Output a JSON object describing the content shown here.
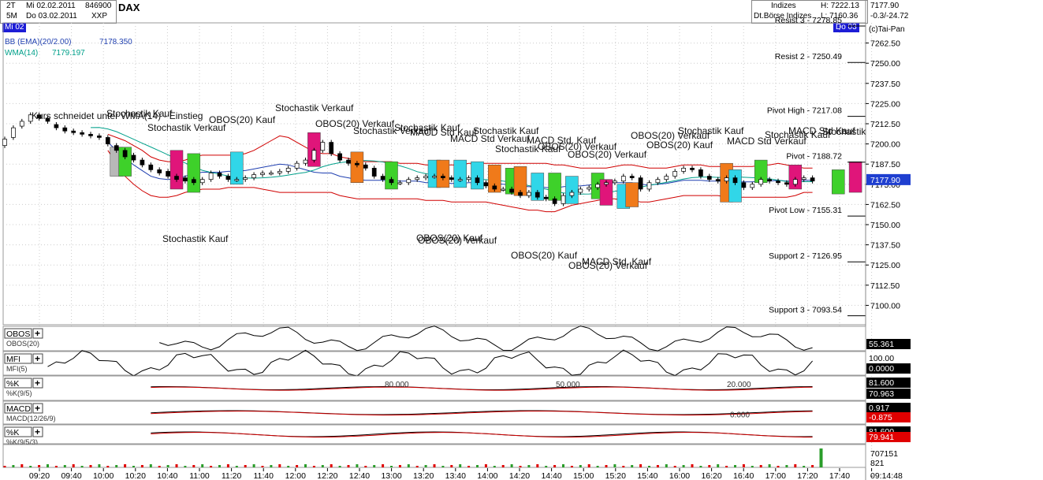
{
  "header": {
    "period1": "2T",
    "date1": "Mi 02.02.2011",
    "code": "846900",
    "title": "DAX",
    "period2": "5M",
    "date2": "Do 03.02.2011",
    "exchange_code": "XXP",
    "market": "Indizes",
    "exchange": "Dt.Börse Indizes",
    "high": "H: 7222.13",
    "low": "L: 7160.36",
    "last": "7177.90",
    "change": "-0.3/-24.72",
    "copyright": "(c)Tai-Pan",
    "day_start": "Mi 02",
    "day_end": "Do 03"
  },
  "legend": {
    "bb_label": "BB (EMA)(20/2.00)",
    "bb_value": "7178.350",
    "wma_label": "WMA(14)",
    "wma_value": "7179.197"
  },
  "colors": {
    "bb": "#d00000",
    "wma": "#1f3fb0",
    "ema": "#00a08a",
    "price_box": "#1f3fd0",
    "neg_box": "#e00000",
    "obos_box": "#f07a1a",
    "stoch_buy": "#3ed12a",
    "stoch_sell": "#e0157a",
    "macd_box": "#31d6e8",
    "gray_box": "#b8b8b8"
  },
  "chart_data": {
    "type": "candlestick",
    "title": "DAX",
    "y_range": [
      7088,
      7275
    ],
    "y_ticks": [
      "7262.50",
      "7250.00",
      "7237.50",
      "7225.00",
      "7212.50",
      "7200.00",
      "7187.50",
      "7175.00",
      "7162.50",
      "7150.00",
      "7137.50",
      "7125.00",
      "7112.50",
      "7100.00"
    ],
    "x_ticks": [
      "09:20",
      "09:40",
      "10:00",
      "10:20",
      "10:40",
      "11:00",
      "11:20",
      "11:40",
      "12:00",
      "12:20",
      "12:40",
      "13:00",
      "13:20",
      "13:40",
      "14:00",
      "14:20",
      "14:40",
      "15:00",
      "15:20",
      "15:40",
      "16:00",
      "16:20",
      "16:40",
      "17:00",
      "17:20",
      "17:40",
      "-"
    ],
    "current_price": "7177.90",
    "time_label": "09:14:48",
    "close": [
      7203,
      7210,
      7214,
      7218,
      7216,
      7214,
      7210,
      7208,
      7207,
      7206,
      7205,
      7204,
      7200,
      7196,
      7192,
      7190,
      7187,
      7184,
      7182,
      7180,
      7178,
      7177,
      7176,
      7178,
      7182,
      7180,
      7178,
      7178,
      7179,
      7181,
      7182,
      7182,
      7183,
      7185,
      7188,
      7190,
      7196,
      7201,
      7194,
      7190,
      7188,
      7187,
      7185,
      7180,
      7178,
      7176,
      7176,
      7178,
      7179,
      7180,
      7180,
      7179,
      7178,
      7178,
      7179,
      7176,
      7174,
      7172,
      7172,
      7170,
      7168,
      7170,
      7167,
      7166,
      7163,
      7168,
      7170,
      7172,
      7173,
      7175,
      7176,
      7177,
      7180,
      7179,
      7172,
      7176,
      7178,
      7180,
      7183,
      7185,
      7184,
      7180,
      7178,
      7177,
      7179,
      7176,
      7173,
      7175,
      7178,
      7177,
      7176,
      7175,
      7178,
      7179,
      7177
    ],
    "open": [
      7199,
      7204,
      7211,
      7214,
      7218,
      7216,
      7212,
      7210,
      7208,
      7207,
      7206,
      7205,
      7204,
      7199,
      7196,
      7193,
      7190,
      7187,
      7184,
      7183,
      7180,
      7179,
      7178,
      7176,
      7178,
      7182,
      7180,
      7178,
      7178,
      7179,
      7181,
      7182,
      7182,
      7183,
      7185,
      7188,
      7190,
      7196,
      7201,
      7194,
      7190,
      7188,
      7187,
      7185,
      7180,
      7178,
      7176,
      7176,
      7178,
      7179,
      7180,
      7180,
      7179,
      7178,
      7178,
      7179,
      7176,
      7174,
      7172,
      7172,
      7170,
      7168,
      7170,
      7167,
      7166,
      7163,
      7168,
      7170,
      7172,
      7173,
      7175,
      7176,
      7177,
      7180,
      7179,
      7172,
      7176,
      7178,
      7180,
      7183,
      7185,
      7184,
      7180,
      7178,
      7177,
      7179,
      7176,
      7173,
      7175,
      7178,
      7177,
      7176,
      7175,
      7178,
      7179
    ],
    "bb_upper": [
      null,
      null,
      null,
      null,
      null,
      null,
      null,
      null,
      null,
      null,
      null,
      null,
      7206,
      7204,
      7202,
      7199,
      7196,
      7192,
      7190,
      7189,
      7189,
      7190,
      7192,
      7193,
      7193,
      7193,
      7193,
      7193,
      7194,
      7196,
      7199,
      7202,
      7205,
      7204,
      7201,
      7198,
      7195,
      7194,
      7194,
      7192,
      7191,
      7190,
      7189,
      7189,
      7189,
      7189,
      7188,
      7188,
      7188,
      7187,
      7187,
      7187,
      7187,
      7187,
      7188,
      7188,
      7188,
      7188,
      7188,
      7188,
      7188,
      7188,
      7188,
      7188,
      7187,
      7187,
      7186,
      7185,
      7185,
      7185,
      7185,
      7186,
      7187,
      7187,
      7186,
      7185,
      7185,
      7185,
      7186,
      7187,
      7187,
      7187,
      7186,
      7186,
      7186,
      7186,
      7186,
      7186,
      7187,
      7187,
      7188,
      7187,
      7186,
      7185,
      7185
    ],
    "bb_lower": [
      null,
      null,
      null,
      null,
      null,
      null,
      null,
      null,
      null,
      null,
      null,
      null,
      7196,
      7188,
      7180,
      7175,
      7171,
      7168,
      7167,
      7167,
      7168,
      7170,
      7171,
      7172,
      7172,
      7172,
      7173,
      7173,
      7173,
      7173,
      7172,
      7171,
      7170,
      7170,
      7170,
      7170,
      7170,
      7170,
      7170,
      7168,
      7167,
      7166,
      7166,
      7166,
      7166,
      7166,
      7166,
      7166,
      7166,
      7165,
      7165,
      7165,
      7164,
      7164,
      7164,
      7164,
      7164,
      7163,
      7162,
      7161,
      7160,
      7159,
      7159,
      7158,
      7158,
      7160,
      7162,
      7163,
      7164,
      7165,
      7166,
      7166,
      7165,
      7165,
      7164,
      7164,
      7165,
      7166,
      7167,
      7168,
      7168,
      7168,
      7168,
      7168,
      7167,
      7167,
      7167,
      7167,
      7167,
      7167,
      7167,
      7167,
      7168,
      7170,
      7170
    ],
    "pivot_levels": [
      {
        "label": "Resist 3 - 7278.85",
        "value": 7278.85
      },
      {
        "label": "Resist 2 - 7250.49",
        "value": 7250.49
      },
      {
        "label": "Pivot High - 7217.08",
        "value": 7217.08
      },
      {
        "label": "Pivot - 7188.72",
        "value": 7188.72
      },
      {
        "label": "Pivot Low - 7155.31",
        "value": 7155.31
      },
      {
        "label": "Support 2 - 7126.95",
        "value": 7126.95
      },
      {
        "label": "Support 3 - 7093.54",
        "value": 7093.54
      }
    ],
    "annotations": [
      {
        "text": "Kurs schneidet unter WMA(14) - Einstieg",
        "x": 40,
        "y": 151
      },
      {
        "text": "Stochastik Kauf",
        "x": 135,
        "y": 148
      },
      {
        "text": "Stochastik Verkauf",
        "x": 187,
        "y": 166
      },
      {
        "text": "OBOS(20) Kauf",
        "x": 265,
        "y": 156
      },
      {
        "text": "Stochastik Verkauf",
        "x": 349,
        "y": 141
      },
      {
        "text": "OBOS(20) Verkauf",
        "x": 400,
        "y": 161
      },
      {
        "text": "Stochastik Verkauf",
        "x": 448,
        "y": 170
      },
      {
        "text": "Stochastik Kauf",
        "x": 500,
        "y": 166
      },
      {
        "text": "MACD Std Kauf",
        "x": 520,
        "y": 172
      },
      {
        "text": "MACD Std Verkauf",
        "x": 571,
        "y": 180
      },
      {
        "text": "Stochastik Kauf",
        "x": 600,
        "y": 170
      },
      {
        "text": "MACD Std. Kauf",
        "x": 668,
        "y": 182
      },
      {
        "text": "Stochastik Kauf",
        "x": 628,
        "y": 193
      },
      {
        "text": "OBOS(20) Verkauf",
        "x": 682,
        "y": 190
      },
      {
        "text": "OBOS(20) Verkauf",
        "x": 720,
        "y": 200
      },
      {
        "text": "Stochastik Kauf",
        "x": 860,
        "y": 170
      },
      {
        "text": "OBOS(20) Verkauf",
        "x": 800,
        "y": 176
      },
      {
        "text": "OBOS(20) Kauf",
        "x": 820,
        "y": 188
      },
      {
        "text": "MACD Std Verkauf",
        "x": 922,
        "y": 183
      },
      {
        "text": "Stochastik Kauf",
        "x": 970,
        "y": 175
      },
      {
        "text": "MACD Std Kauf",
        "x": 1000,
        "y": 170
      },
      {
        "text": "Stochastik",
        "x": 1043,
        "y": 171
      },
      {
        "text": "Stochastik Kauf",
        "x": 206,
        "y": 307
      },
      {
        "text": "OBOS(20) Kauf",
        "x": 528,
        "y": 306
      },
      {
        "text": "OBOS(20) Verkauf",
        "x": 530,
        "y": 309
      },
      {
        "text": "OBOS(20) Kauf",
        "x": 648,
        "y": 328
      },
      {
        "text": "MACD Std. Kauf",
        "x": 738,
        "y": 336
      },
      {
        "text": "OBOS(20) Verkauf",
        "x": 721,
        "y": 341
      }
    ],
    "signal_boxes": [
      {
        "i": 13,
        "color": "gray_box",
        "lo": 7180,
        "hi": 7198
      },
      {
        "i": 14,
        "color": "stoch_buy",
        "lo": 7180,
        "hi": 7198
      },
      {
        "i": 20,
        "color": "stoch_sell",
        "lo": 7172,
        "hi": 7196
      },
      {
        "i": 22,
        "color": "stoch_buy",
        "lo": 7170,
        "hi": 7194
      },
      {
        "i": 27,
        "color": "macd_box",
        "lo": 7175,
        "hi": 7195
      },
      {
        "i": 36,
        "color": "stoch_sell",
        "lo": 7186,
        "hi": 7207
      },
      {
        "i": 41,
        "color": "obos_box",
        "lo": 7176,
        "hi": 7195
      },
      {
        "i": 45,
        "color": "stoch_buy",
        "lo": 7172,
        "hi": 7189
      },
      {
        "i": 50,
        "color": "macd_box",
        "lo": 7173,
        "hi": 7190
      },
      {
        "i": 51,
        "color": "obos_box",
        "lo": 7173,
        "hi": 7190
      },
      {
        "i": 53,
        "color": "macd_box",
        "lo": 7173,
        "hi": 7190
      },
      {
        "i": 55,
        "color": "macd_box",
        "lo": 7172,
        "hi": 7189
      },
      {
        "i": 57,
        "color": "obos_box",
        "lo": 7170,
        "hi": 7187
      },
      {
        "i": 59,
        "color": "stoch_buy",
        "lo": 7169,
        "hi": 7185
      },
      {
        "i": 60,
        "color": "obos_box",
        "lo": 7168,
        "hi": 7186
      },
      {
        "i": 62,
        "color": "macd_box",
        "lo": 7165,
        "hi": 7182
      },
      {
        "i": 64,
        "color": "stoch_buy",
        "lo": 7165,
        "hi": 7182
      },
      {
        "i": 66,
        "color": "macd_box",
        "lo": 7163,
        "hi": 7180
      },
      {
        "i": 69,
        "color": "stoch_buy",
        "lo": 7166,
        "hi": 7182
      },
      {
        "i": 70,
        "color": "stoch_sell",
        "lo": 7162,
        "hi": 7178
      },
      {
        "i": 72,
        "color": "macd_box",
        "lo": 7160,
        "hi": 7175
      },
      {
        "i": 73,
        "color": "obos_box",
        "lo": 7161,
        "hi": 7176
      },
      {
        "i": 84,
        "color": "obos_box",
        "lo": 7164,
        "hi": 7188
      },
      {
        "i": 85,
        "color": "macd_box",
        "lo": 7164,
        "hi": 7184
      },
      {
        "i": 88,
        "color": "stoch_buy",
        "lo": 7176,
        "hi": 7190
      },
      {
        "i": 92,
        "color": "stoch_sell",
        "lo": 7172,
        "hi": 7187
      },
      {
        "i": 97,
        "color": "stoch_buy",
        "lo": 7169,
        "hi": 7184
      },
      {
        "i": 99,
        "color": "stoch_sell",
        "lo": 7170,
        "hi": 7189
      }
    ],
    "indicators": [
      {
        "name": "OBOS",
        "sub": "OBOS(20)",
        "value": "55.361",
        "value_bg": "#000"
      },
      {
        "name": "MFI",
        "sub": "MFI(5)",
        "value_top": "100.00",
        "value": "0.0000",
        "value_bg": "#000"
      },
      {
        "name": "%K",
        "sub": "%K(9/5)",
        "value_top": "81.600",
        "value": "70.963",
        "value_bg": "#000",
        "levels": [
          "80.000",
          "50.000",
          "20.000"
        ]
      },
      {
        "name": "MACD",
        "sub": "MACD(12/26/9)",
        "value_top": "0.917",
        "value": "-0.875",
        "value_bg": "#e00000",
        "levels": [
          "0.000"
        ]
      },
      {
        "name": "%K",
        "sub": "%K(9/5/3)",
        "value_top": "81.600",
        "value": "79.941",
        "value_bg": "#e00000"
      }
    ],
    "volume": {
      "top": "707151",
      "bottom": "821"
    }
  }
}
